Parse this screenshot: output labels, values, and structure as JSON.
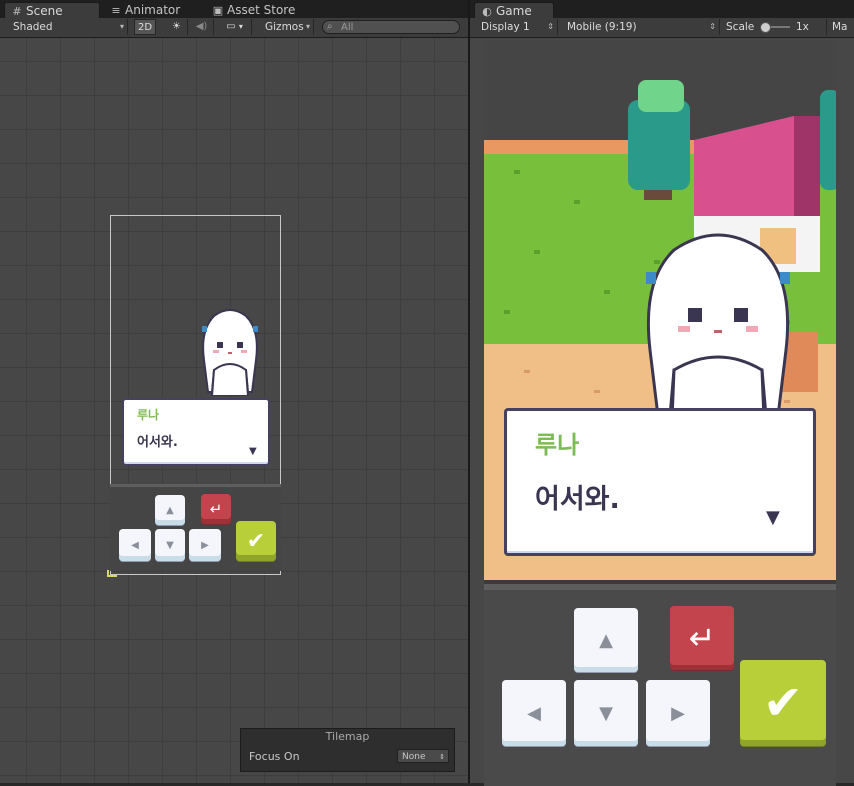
{
  "scene_tabs": [
    {
      "icon": "#",
      "label": "Scene"
    },
    {
      "icon": "≡",
      "label": "Animator"
    },
    {
      "icon": "▣",
      "label": "Asset Store"
    }
  ],
  "scene_toolbar": {
    "shading": "Shaded",
    "mode_2d": "2D",
    "lighting_icon": "☀",
    "audio_icon": "◀)",
    "image_icon": "▭",
    "gizmos": "Gizmos",
    "search_placeholder": "All"
  },
  "game_tabs": [
    {
      "icon": "◐",
      "label": "Game"
    }
  ],
  "game_toolbar": {
    "display": "Display 1",
    "aspect": "Mobile (9:19)",
    "scale_label": "Scale",
    "scale_value": "1x",
    "maximize": "Ma"
  },
  "dialog": {
    "speaker": "루나",
    "message": "어서와.",
    "more_indicator": "▼"
  },
  "controls": {
    "up": "▲",
    "down": "▼",
    "left": "◀",
    "right": "▶",
    "enter": "↵",
    "confirm": "✔"
  },
  "tilemap": {
    "title": "Tilemap",
    "focus_label": "Focus On",
    "focus_value": "None"
  },
  "colors": {
    "speaker_green": "#7dbb54",
    "confirm_green": "#b8cf3a",
    "enter_red": "#c4444d",
    "grass": "#78c03c",
    "path": "#f0bf88"
  }
}
